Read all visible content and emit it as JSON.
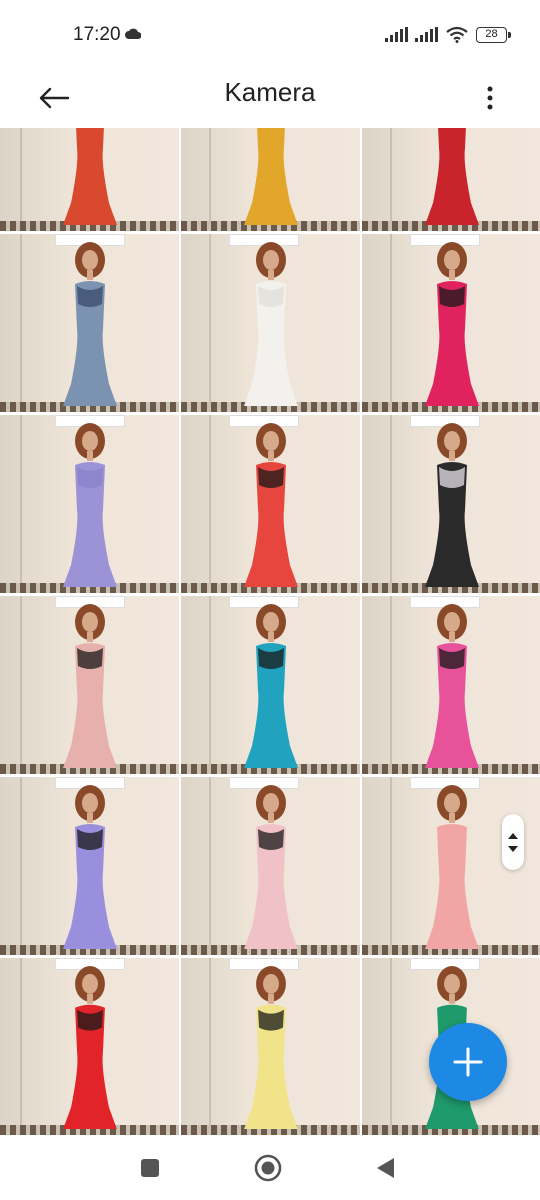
{
  "status_bar": {
    "time": "17:20",
    "battery_level": "28",
    "icons": [
      "cloud-icon",
      "signal-icon",
      "signal-icon",
      "wifi-icon",
      "battery-icon"
    ]
  },
  "app_bar": {
    "title": "Kamera",
    "back_icon": "arrow-left-icon",
    "menu_icon": "more-vert-icon"
  },
  "gallery": {
    "columns": 3,
    "photos": [
      {
        "dress_color": "#d8492e",
        "accent": "#2a3f8a"
      },
      {
        "dress_color": "#e2a62a",
        "accent": "#d89a1e"
      },
      {
        "dress_color": "#c9232b",
        "accent": "#a81b22"
      },
      {
        "dress_color": "#7b93b0",
        "accent": "#3a4a6a"
      },
      {
        "dress_color": "#f3f1ee",
        "accent": "#e0ddd8"
      },
      {
        "dress_color": "#e0235f",
        "accent": "#1a1a1a"
      },
      {
        "dress_color": "#9c92d6",
        "accent": "#8a80c8"
      },
      {
        "dress_color": "#e6463d",
        "accent": "#1a1a1a"
      },
      {
        "dress_color": "#2a2a2a",
        "accent": "#e8e2e8"
      },
      {
        "dress_color": "#e6b1ad",
        "accent": "#1a1a1a"
      },
      {
        "dress_color": "#21a3c0",
        "accent": "#1a1a1a"
      },
      {
        "dress_color": "#e8529a",
        "accent": "#1a1a1a"
      },
      {
        "dress_color": "#9a8fdc",
        "accent": "#1a1a1a"
      },
      {
        "dress_color": "#f0c2c8",
        "accent": "#1a1a1a"
      },
      {
        "dress_color": "#f2a5a5",
        "accent": "#f2a5a5"
      },
      {
        "dress_color": "#e2242a",
        "accent": "#1a1a1a"
      },
      {
        "dress_color": "#f0e38a",
        "accent": "#1a1a1a"
      },
      {
        "dress_color": "#1f9a6c",
        "accent": "#1f9a6c"
      }
    ]
  },
  "scroll_handle_icon": "scroll-up-down-icon",
  "fab": {
    "icon": "plus-icon",
    "color": "#1e88e5"
  },
  "nav_bar": {
    "icons": [
      "recents-square-icon",
      "home-circle-icon",
      "back-triangle-icon"
    ]
  }
}
